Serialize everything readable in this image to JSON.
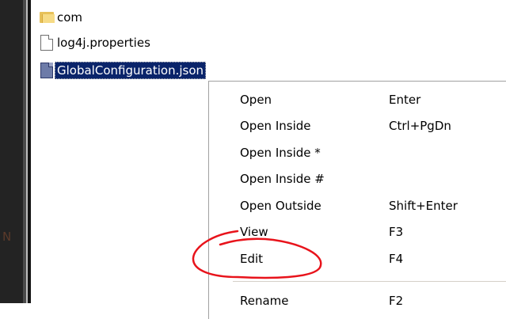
{
  "tree": {
    "items": [
      {
        "label": "com",
        "icon": "folder-icon"
      },
      {
        "label": "log4j.properties",
        "icon": "file-icon"
      },
      {
        "label": "GlobalConfiguration.json",
        "icon": "file-icon",
        "selected": true
      }
    ]
  },
  "left_strip": {
    "glyph": "N"
  },
  "context_menu": {
    "items": [
      {
        "label": "Open",
        "shortcut": "Enter"
      },
      {
        "label": "Open Inside",
        "shortcut": "Ctrl+PgDn"
      },
      {
        "label": "Open Inside *",
        "shortcut": ""
      },
      {
        "label": "Open Inside #",
        "shortcut": ""
      },
      {
        "label": "Open Outside",
        "shortcut": "Shift+Enter"
      },
      {
        "label": "View",
        "shortcut": "F3"
      },
      {
        "label": "Edit",
        "shortcut": "F4",
        "highlighted_by_annotation": true
      },
      {
        "label": "Rename",
        "shortcut": "F2"
      }
    ]
  },
  "colors": {
    "selection_bg": "#0a246a",
    "annotation": "#e8131b",
    "dark_panel": "#232323"
  }
}
